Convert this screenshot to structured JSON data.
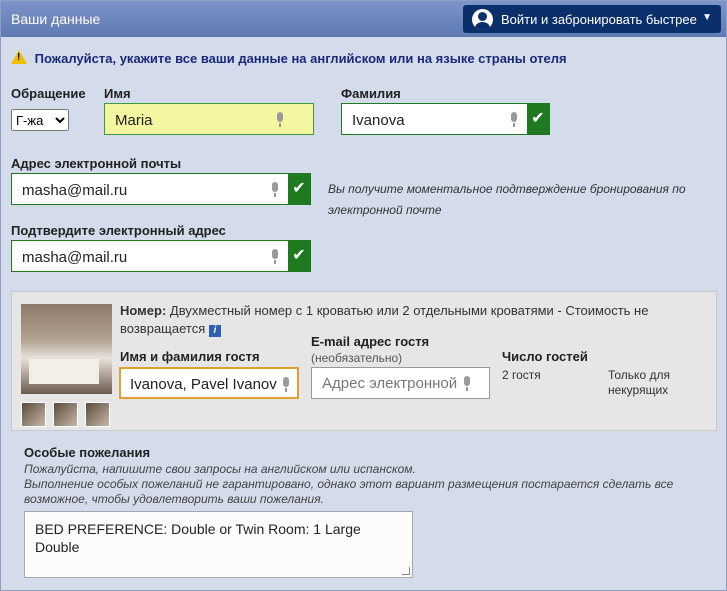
{
  "header": {
    "title": "Ваши данные",
    "signin_label": "Войти и забронировать быстрее"
  },
  "warning": {
    "text": "Пожалуйста, укажите все ваши данные на английском или на языке страны отеля"
  },
  "form": {
    "salutation_label": "Обращение",
    "salutation_value": "Г-жа",
    "first_name_label": "Имя",
    "first_name_value": "Maria",
    "last_name_label": "Фамилия",
    "last_name_value": "Ivanova",
    "email_label": "Адрес электронной почты",
    "email_value": "masha@mail.ru",
    "email_note": "Вы получите моментальное подтверждение бронирования по электронной почте",
    "confirm_email_label": "Подтвердите электронный адрес",
    "confirm_email_value": "masha@mail.ru"
  },
  "room": {
    "label": "Номер:",
    "description": "Двухместный номер с 1 кроватью или 2 отдельными кроватями - Стоимость не возвращается",
    "info_icon": "i",
    "guest_name_label": "Имя и фамилия гостя",
    "guest_name_value": "Ivanova, Pavel Ivanov",
    "guest_email_label": "E-mail адрес гостя",
    "guest_email_optional": "(необязательно)",
    "guest_email_placeholder": "Адрес электронной п",
    "guests_label": "Число гостей",
    "guests_value": "2 гостя",
    "non_smoking": "Только для некурящих"
  },
  "requests": {
    "title": "Особые пожелания",
    "hint1": "Пожалуйста, напишите свои запросы на английском или испанском.",
    "hint2": "Выполнение особых пожеланий не гарантировано, однако этот вариант размещения постарается сделать все возможное, чтобы удовлетворить ваши пожелания.",
    "value": "BED PREFERENCE: Double or Twin Room: 1 Large Double"
  },
  "icons": {
    "warning": "warning-icon",
    "mic": "microphone-icon",
    "check": "checkmark-icon",
    "user": "user-avatar-icon",
    "info": "info-icon",
    "caret": "chevron-down-icon"
  },
  "colors": {
    "header_bg": "#6a82bc",
    "signin_bg": "#0b2f6b",
    "valid_green": "#1f7a1f",
    "focus_yellow": "#f4f7a0",
    "guest_focus_orange": "#e0a030"
  }
}
